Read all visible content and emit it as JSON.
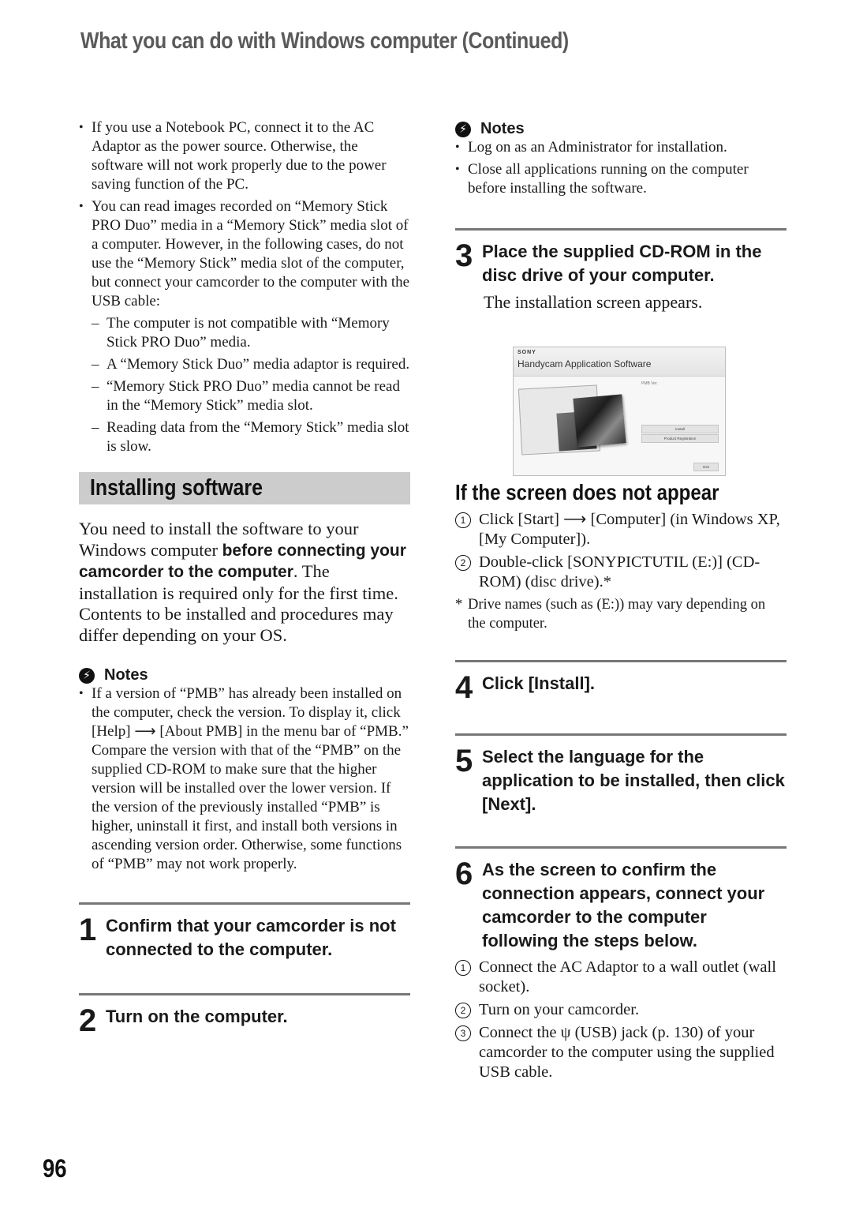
{
  "header": {
    "title": "What you can do with Windows computer (Continued)"
  },
  "left": {
    "bullets": [
      {
        "text": "If you use a Notebook PC, connect it to the AC Adaptor as the power source. Otherwise, the software will not work properly due to the power saving function of the PC."
      },
      {
        "text": "You can read images recorded on “Memory Stick PRO Duo” media in a “Memory Stick” media slot of a computer. However, in the following cases, do not use the “Memory Stick” media slot of the computer, but connect your camcorder to the computer with the USB cable:"
      }
    ],
    "dashes": [
      "The computer is not compatible with “Memory Stick PRO Duo” media.",
      "A “Memory Stick Duo” media adaptor is required.",
      "“Memory Stick PRO Duo” media cannot be read in the “Memory Stick” media slot.",
      "Reading data from the “Memory Stick” media slot is slow."
    ],
    "section_title": "Installing software",
    "intro": {
      "part1": "You need to install the software to your Windows computer ",
      "bold": "before connecting your camcorder to the computer",
      "part2": ". The installation is required only for the first time.",
      "line2": "Contents to be installed and procedures may differ depending on your OS."
    },
    "notes": {
      "label": "Notes",
      "items": [
        "If a version of “PMB” has already been installed on the computer, check the version. To display it, click [Help] ⟶ [About PMB] in the menu bar of “PMB.” Compare the version with that of the “PMB” on the supplied CD-ROM to make sure that the higher version will be installed over the lower version. If the version of the previously installed “PMB” is higher, uninstall it first, and install both versions in ascending version order. Otherwise, some functions of “PMB” may not work properly."
      ]
    },
    "steps": [
      {
        "num": "1",
        "text": "Confirm that your camcorder is not connected to the computer."
      },
      {
        "num": "2",
        "text": "Turn on the computer."
      }
    ]
  },
  "right": {
    "notes": {
      "label": "Notes",
      "items": [
        "Log on as an Administrator for installation.",
        "Close all applications running on the computer before installing the software."
      ]
    },
    "step3": {
      "num": "3",
      "text": "Place the supplied CD-ROM in the disc drive of your computer.",
      "sub": "The installation screen appears."
    },
    "installer": {
      "brand": "SONY",
      "title": "Handycam Application Software",
      "version_label": "PMB Ver.",
      "buttons": [
        "Install",
        "Product Registration"
      ],
      "exit": "Exit"
    },
    "fallback": {
      "title": "If the screen does not appear",
      "items": [
        {
          "mark": "1",
          "text": "Click [Start] ⟶ [Computer] (in Windows XP, [My Computer])."
        },
        {
          "mark": "2",
          "text": "Double-click [SONYPICTUTIL (E:)] (CD-ROM) (disc drive).*"
        }
      ],
      "footnote_mark": "*",
      "footnote": "Drive names (such as (E:)) may vary depending on the computer."
    },
    "steps": [
      {
        "num": "4",
        "text": "Click [Install]."
      },
      {
        "num": "5",
        "text": "Select the language for the application to be installed, then click [Next]."
      },
      {
        "num": "6",
        "text": "As the screen to confirm the connection appears, connect your camcorder to the computer following the steps below."
      }
    ],
    "step6_items": [
      {
        "mark": "1",
        "text": "Connect the AC Adaptor to a wall outlet (wall socket)."
      },
      {
        "mark": "2",
        "text": "Turn on your camcorder."
      },
      {
        "mark": "3",
        "text": "Connect the ψ (USB) jack (p. 130) of your camcorder to the computer using the supplied USB cable."
      }
    ]
  },
  "footer": {
    "page_number": "96"
  },
  "colors": {
    "header_gray": "#5a5a5a",
    "section_bar": "#cccccc",
    "rule": "#777777",
    "text": "#1a1a1a"
  }
}
